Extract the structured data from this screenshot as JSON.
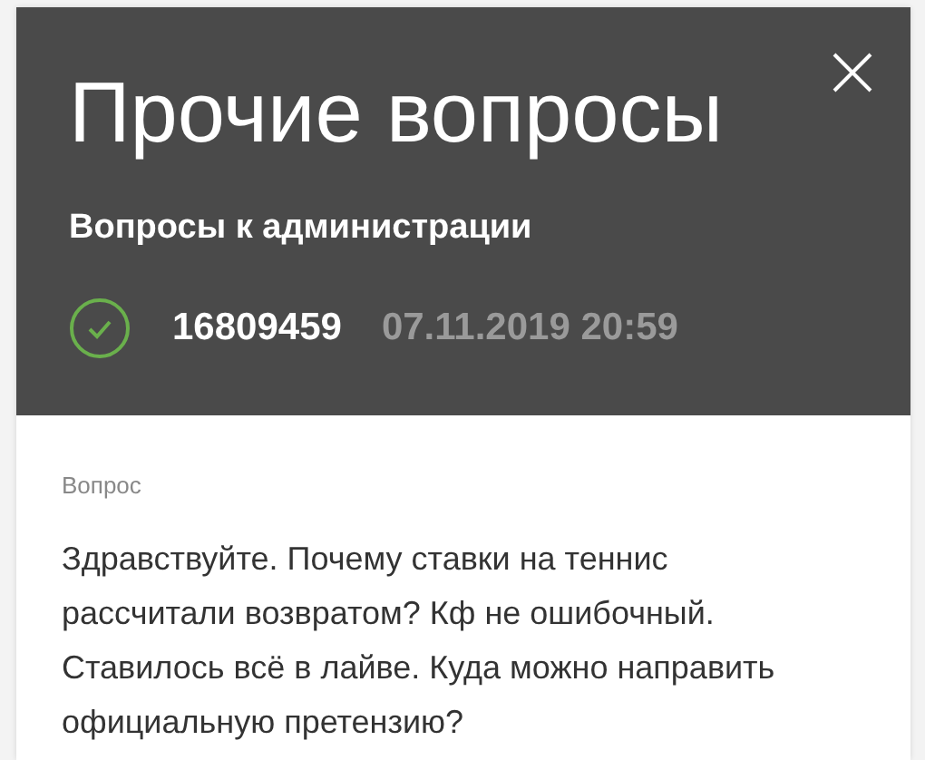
{
  "header": {
    "title": "Прочие вопросы",
    "category": "Вопросы к администрации",
    "resolved": true,
    "number": "16809459",
    "datetime": "07.11.2019 20:59"
  },
  "body": {
    "label": "Вопрос",
    "text": "Здравствуйте. Почему ставки на теннис рассчитали возвратом? Кф не ошибочный. Ставилось всё в лайве. Куда можно направить официальную претензию?"
  }
}
